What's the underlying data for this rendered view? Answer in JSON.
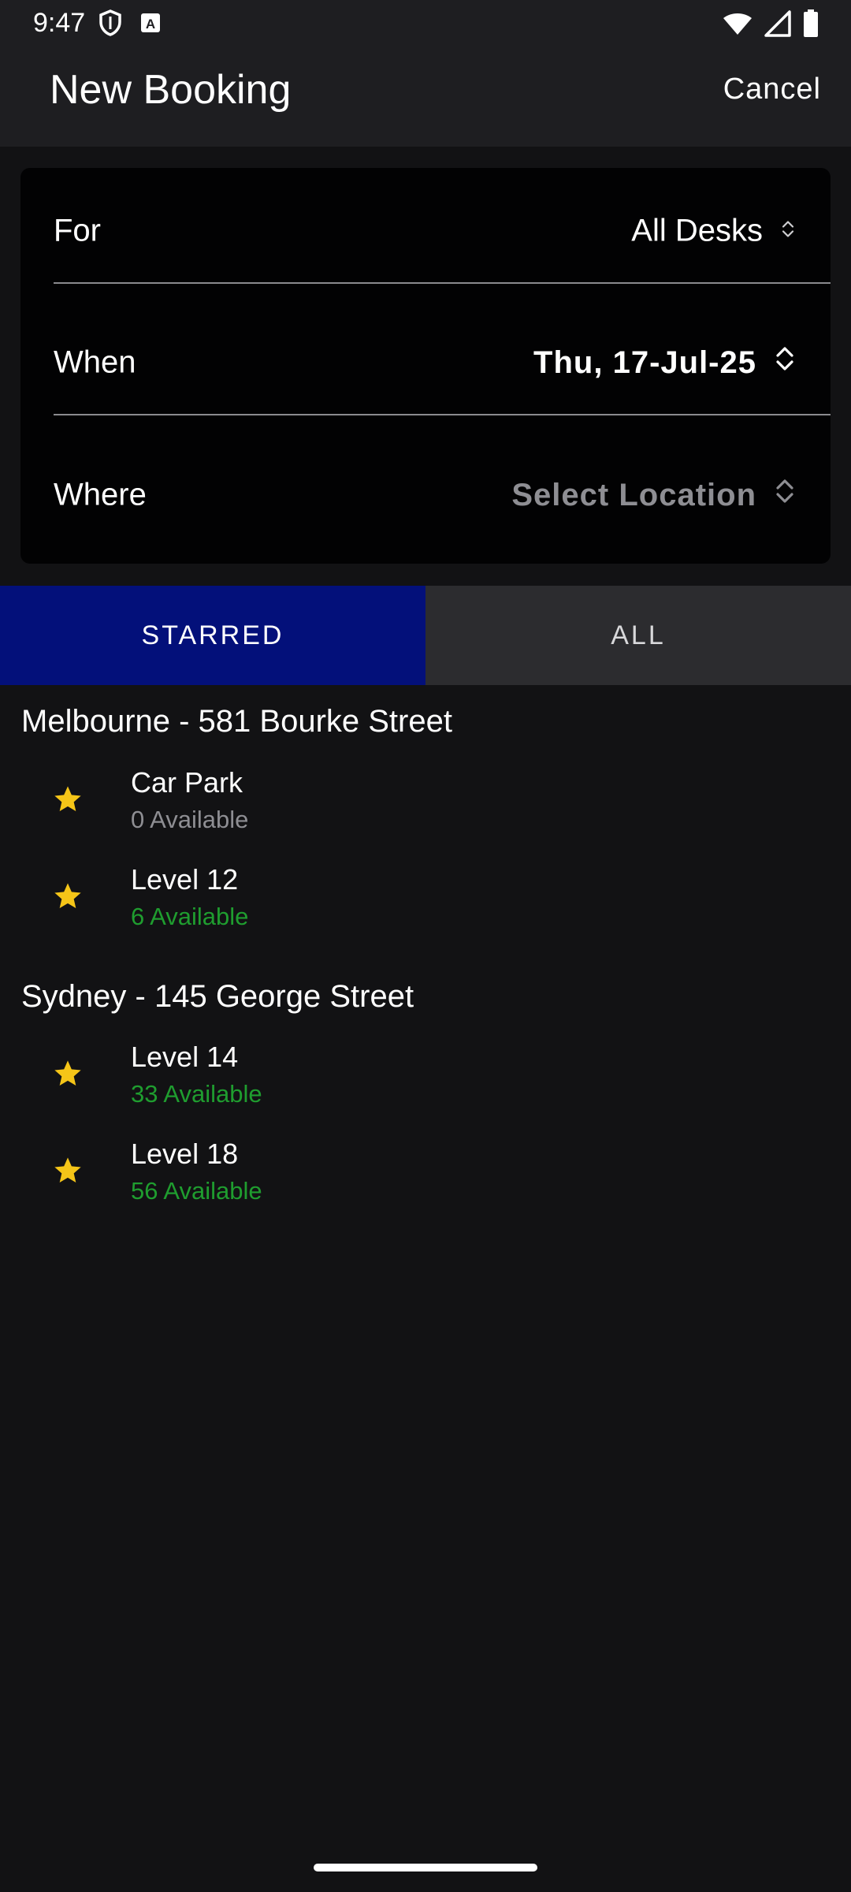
{
  "status_bar": {
    "time": "9:47"
  },
  "header": {
    "title": "New Booking",
    "cancel_label": "Cancel"
  },
  "form": {
    "rows": [
      {
        "label": "For",
        "value": "All Desks"
      },
      {
        "label": "When",
        "value": "Thu, 17-Jul-25"
      },
      {
        "label": "Where",
        "value": "Select Location"
      }
    ]
  },
  "tabs": [
    {
      "label": "STARRED",
      "selected": true
    },
    {
      "label": "ALL",
      "selected": false
    }
  ],
  "groups": [
    {
      "title": "Melbourne - 581 Bourke Street",
      "items": [
        {
          "name": "Car Park",
          "availability": "0 Available"
        },
        {
          "name": "Level 12",
          "availability": "6 Available"
        }
      ]
    },
    {
      "title": "Sydney - 145 George Street",
      "items": [
        {
          "name": "Level 14",
          "availability": "33 Available"
        },
        {
          "name": "Level 18",
          "availability": "56 Available"
        }
      ]
    }
  ],
  "colors": {
    "background": "#121214",
    "header": "#1e1e21",
    "card": "#020203",
    "tab_selected": "#03107a",
    "tab_unselected": "#2c2c2f",
    "star": "#f5c518",
    "available": "#1f9d2f",
    "unavailable": "#8e8e93",
    "placeholder": "#8e8e93"
  },
  "icons": {
    "status_left": [
      "shield-icon",
      "keyboard-a-icon"
    ],
    "status_right": [
      "wifi-icon",
      "signal-icon",
      "battery-icon"
    ],
    "row_chevron": "chevron-up-down-icon",
    "favourite": "star-icon"
  }
}
